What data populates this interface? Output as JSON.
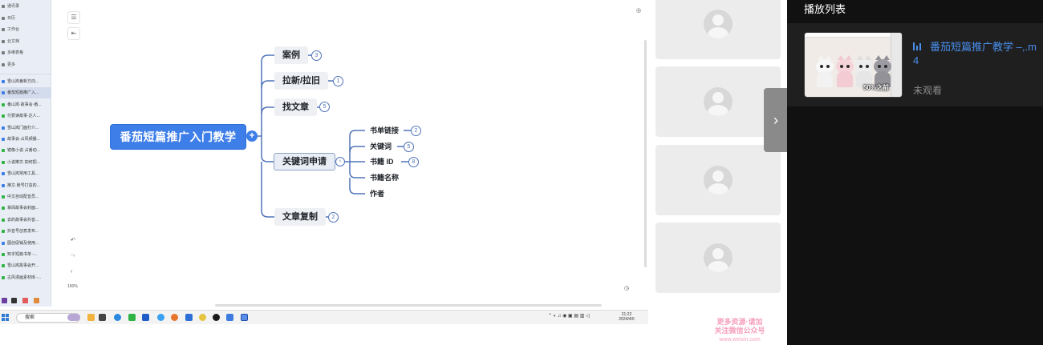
{
  "sidebar": {
    "nav": [
      {
        "label": "通讯录",
        "color": "#7a7a7a"
      },
      {
        "label": "日历",
        "color": "#7a7a7a"
      },
      {
        "label": "工作台",
        "color": "#7a7a7a"
      },
      {
        "label": "云文档",
        "color": "#7a7a7a"
      },
      {
        "label": "多维表格",
        "color": "#7a7a7a"
      },
      {
        "label": "更多",
        "color": "#7a7a7a"
      }
    ],
    "docs": [
      {
        "label": "雪山岚番新方向...",
        "color": "#3d7ee8",
        "active": false
      },
      {
        "label": "番茄短篇推广入...",
        "color": "#3d7ee8",
        "active": true
      },
      {
        "label": "番山岚·故事会·番...",
        "color": "#2fb344",
        "active": false
      },
      {
        "label": "付费读故事·达人...",
        "color": "#2fb344",
        "active": false
      },
      {
        "label": "雪山岚门面打介...",
        "color": "#3d7ee8",
        "active": false
      },
      {
        "label": "故事会·占风频播...",
        "color": "#3d7ee8",
        "active": false
      },
      {
        "label": "镜像小说·占番动...",
        "color": "#2fb344",
        "active": false
      },
      {
        "label": "小说推文·如何把...",
        "color": "#2fb344",
        "active": false
      },
      {
        "label": "雪山岚常用工具...",
        "color": "#3d7ee8",
        "active": false
      },
      {
        "label": "推文·账号打造的...",
        "color": "#3d7ee8",
        "active": false
      },
      {
        "label": "中文自动配音员...",
        "color": "#2fb344",
        "active": false
      },
      {
        "label": "掌阅故事会封面...",
        "color": "#2fb344",
        "active": false
      },
      {
        "label": "去的故事会抖音...",
        "color": "#2fb344",
        "active": false
      },
      {
        "label": "抖音号创意发布...",
        "color": "#2fb344",
        "active": false
      },
      {
        "label": "图创促销及使用...",
        "color": "#3d7ee8",
        "active": false
      },
      {
        "label": "知乎短篇书单 -...",
        "color": "#2fb344",
        "active": false
      },
      {
        "label": "雪山岚故事会开...",
        "color": "#2fb344",
        "active": false
      },
      {
        "label": "古风漫画素材库 -...",
        "color": "#2fb344",
        "active": false
      }
    ]
  },
  "mindmap": {
    "root": "番茄短篇推广入门教学",
    "root_plus": "+",
    "branches": [
      {
        "label": "案例",
        "count": "3"
      },
      {
        "label": "拉新/拉旧",
        "count": "1"
      },
      {
        "label": "找文章",
        "count": "5"
      },
      {
        "label": "关键词申请",
        "count": ""
      },
      {
        "label": "文章复制",
        "count": "2"
      }
    ],
    "collapse_glyph": "‹",
    "keyword_children": [
      {
        "label": "书单链接",
        "count": "2"
      },
      {
        "label": "关键词",
        "count": "5"
      },
      {
        "label": "书籍 ID",
        "count": "8"
      },
      {
        "label": "书籍名称",
        "count": ""
      },
      {
        "label": "作者",
        "count": ""
      }
    ],
    "zoom": "150%"
  },
  "taskbar": {
    "search_placeholder": "搜索",
    "time": "21:22",
    "date": "2024/4/6"
  },
  "playlist": {
    "title": "播放列表",
    "items": [
      {
        "title_line1": "番茄短篇推广教学 –,.m",
        "title_line2": "4",
        "status": "未观看",
        "thumb_caption": "50%之前"
      }
    ]
  },
  "watermark": {
    "line1": "更多资源·请加",
    "line2": "关注微信公众号",
    "line3": "www.weixin.com"
  },
  "colors": {
    "accent": "#3d7ee8",
    "panel_bg": "#111111",
    "playlist_title": "#4a90f0"
  }
}
